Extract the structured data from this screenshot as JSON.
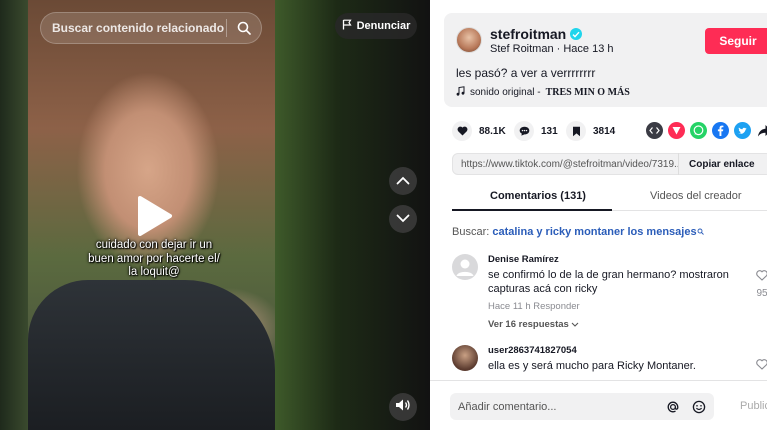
{
  "video": {
    "search_placeholder": "Buscar contenido relacionado",
    "report_label": "Denunciar",
    "caption": "cuidado con dejar ir un buen amor por hacerte el/ la loquit@"
  },
  "author": {
    "username": "stefroitman",
    "subline": "Stef Roitman · Hace 13 h",
    "follow_label": "Seguir"
  },
  "post": {
    "description": "les pasó? a ver a verrrrrrrr",
    "music_prefix": "sonido original -",
    "music_title": "TRES MIN O MÁS"
  },
  "stats": {
    "likes": "88.1K",
    "comments": "131",
    "saves": "3814"
  },
  "share": {
    "url": "https://www.tiktok.com/@stefroitman/video/7319...",
    "copy_label": "Copiar enlace",
    "colors": {
      "embed": "#161823",
      "friends": "#fe2c55",
      "whatsapp": "#25d366",
      "facebook": "#1877f2",
      "twitter": "#1da1f2"
    }
  },
  "tabs": {
    "comments": "Comentarios (131)",
    "creator": "Videos del creador"
  },
  "related": {
    "label": "Buscar:",
    "query": "catalina y ricky montaner los mensajes"
  },
  "comments": [
    {
      "name": "Denise Ramírez",
      "text": "se confirmó lo de la de gran hermano? mostraron capturas acá con ricky",
      "meta": "Hace 11 h   Responder",
      "replies": "Ver 16 respuestas",
      "likes": "95"
    },
    {
      "name": "user2863741827054",
      "text": "ella es y será mucho para Ricky Montaner."
    }
  ],
  "composer": {
    "placeholder": "Añadir comentario...",
    "post_label": "Publicar"
  },
  "accent_color": "#fe2c55"
}
